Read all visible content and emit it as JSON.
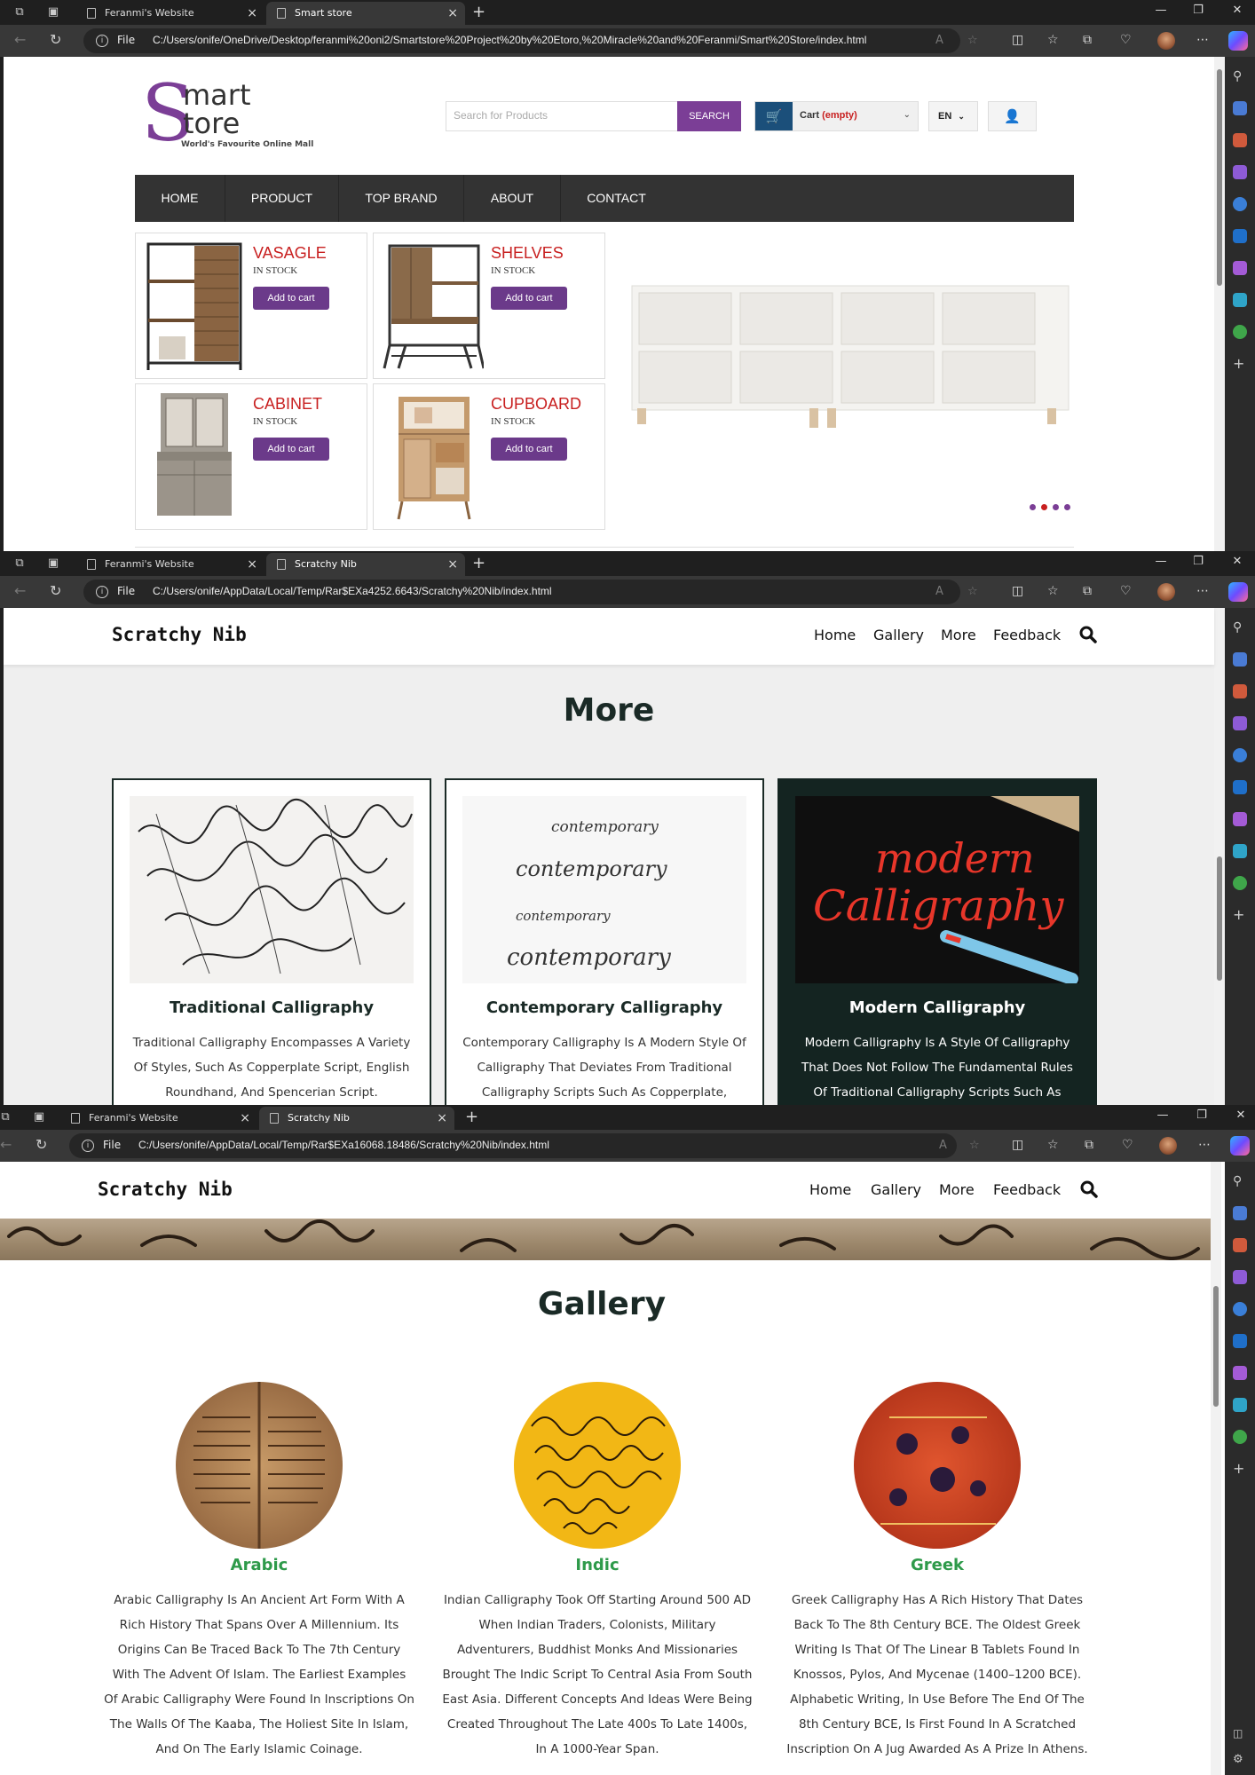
{
  "windows": [
    {
      "tabs": [
        "Feranmi's Website",
        "Smart store"
      ],
      "url": "C:/Users/onife/OneDrive/Desktop/feranmi%20oni2/Smartstore%20Project%20by%20Etoro,%20Miracle%20and%20Feranmi/Smart%20Store/index.html"
    },
    {
      "tabs": [
        "Feranmi's Website",
        "Scratchy Nib"
      ],
      "url": "C:/Users/onife/AppData/Local/Temp/Rar$EXa4252.6643/Scratchy%20Nib/index.html"
    },
    {
      "tabs": [
        "Feranmi's Website",
        "Scratchy Nib"
      ],
      "url": "C:/Users/onife/AppData/Local/Temp/Rar$EXa16068.18486/Scratchy%20Nib/index.html"
    }
  ],
  "browser": {
    "file_label": "File"
  },
  "smartstore": {
    "logo": {
      "s": "S",
      "word1": "mart",
      "word2": "tore",
      "tagline": "World's Favourite Online Mall"
    },
    "search": {
      "placeholder": "Search for Products",
      "button": "SEARCH"
    },
    "cart": {
      "label": "Cart",
      "status": "(empty)"
    },
    "lang": "EN",
    "nav": [
      "HOME",
      "PRODUCT",
      "TOP BRAND",
      "ABOUT",
      "CONTACT"
    ],
    "products": [
      {
        "name": "VASAGLE",
        "stock": "IN STOCK",
        "button": "Add to cart"
      },
      {
        "name": "SHELVES",
        "stock": "IN STOCK",
        "button": "Add to cart"
      },
      {
        "name": "CABINET",
        "stock": "IN STOCK",
        "button": "Add to cart"
      },
      {
        "name": "CUPBOARD",
        "stock": "IN STOCK",
        "button": "Add to cart"
      }
    ],
    "colors": {
      "accent": "#7b3e96",
      "price_red": "#c82020",
      "nav_bg": "#333333"
    }
  },
  "scratchy_more": {
    "brand": "Scratchy Nib",
    "nav": [
      "Home",
      "Gallery",
      "More",
      "Feedback"
    ],
    "heading": "More",
    "cards": [
      {
        "title": "Traditional Calligraphy",
        "text": "Traditional Calligraphy Encompasses A Variety Of Styles, Such As Copperplate Script, English Roundhand, And Spencerian Script."
      },
      {
        "title": "Contemporary Calligraphy",
        "text": "Contemporary Calligraphy Is A Modern Style Of Calligraphy That Deviates From Traditional Calligraphy Scripts Such As Copperplate,"
      },
      {
        "title": "Modern Calligraphy",
        "text": "Modern Calligraphy Is A Style Of Calligraphy That Does Not Follow The Fundamental Rules Of Traditional Calligraphy Scripts Such As"
      }
    ],
    "image_text": {
      "modern": [
        "modern",
        "Calligraphy"
      ],
      "contemporary": "contemporary"
    }
  },
  "scratchy_gallery": {
    "brand": "Scratchy Nib",
    "nav": [
      "Home",
      "Gallery",
      "More",
      "Feedback"
    ],
    "heading": "Gallery",
    "items": [
      {
        "name": "Arabic",
        "text": "Arabic Calligraphy Is An Ancient Art Form With A Rich History That Spans Over A Millennium. Its Origins Can Be Traced Back To The 7th Century With The Advent Of Islam. The Earliest Examples Of Arabic Calligraphy Were Found In Inscriptions On The Walls Of The Kaaba, The Holiest Site In Islam, And On The Early Islamic Coinage."
      },
      {
        "name": "Indic",
        "text": "Indian Calligraphy Took Off Starting Around 500 AD When Indian Traders, Colonists, Military Adventurers, Buddhist Monks And Missionaries Brought The Indic Script To Central Asia From South East Asia. Different Concepts And Ideas Were Being Created Throughout The Late 400s To Late 1400s, In A 1000-Year Span."
      },
      {
        "name": "Greek",
        "text": "Greek Calligraphy Has A Rich History That Dates Back To The 8th Century BCE. The Oldest Greek Writing Is That Of The Linear B Tablets Found In Knossos, Pylos, And Mycenae (1400–1200 BCE). Alphabetic Writing, In Use Before The End Of The 8th Century BCE, Is First Found In A Scratched Inscription On A Jug Awarded As A Prize In Athens."
      }
    ],
    "colors": {
      "name_green": "#2e9a4a"
    }
  }
}
